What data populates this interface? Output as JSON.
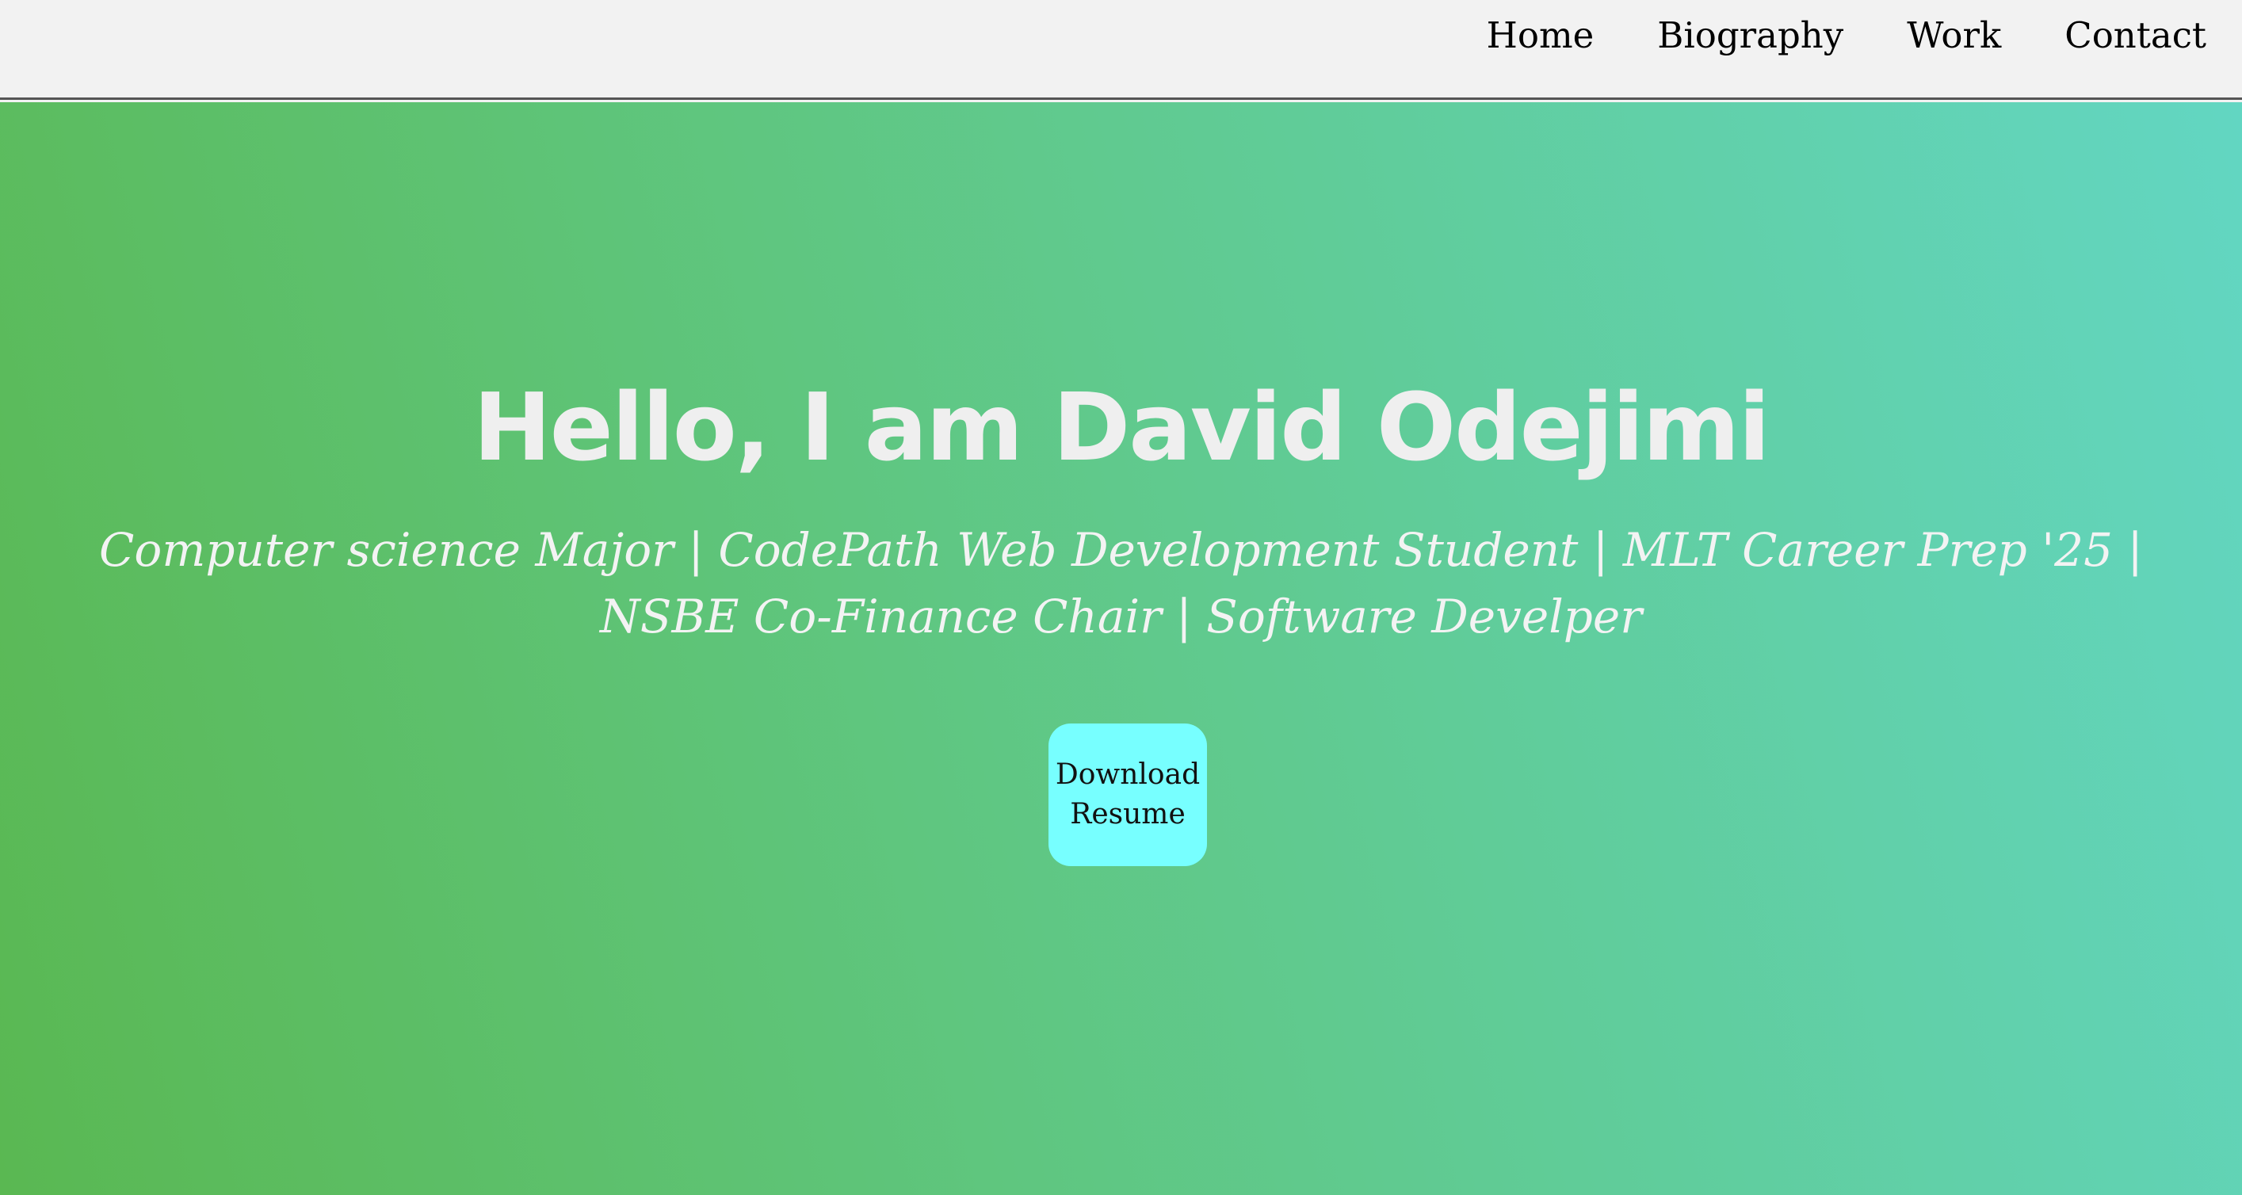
{
  "nav": {
    "items": [
      {
        "label": "Home"
      },
      {
        "label": "Biography"
      },
      {
        "label": "Work"
      },
      {
        "label": "Contact"
      }
    ]
  },
  "hero": {
    "title": "Hello, I am David Odejimi",
    "subtitle": "Computer science Major | CodePath Web Development Student | MLT Career Prep '25 | NSBE Co-Finance Chair | Software Develper",
    "download_button_label": "Download Resume"
  },
  "colors": {
    "gradient_start": "#5ab852",
    "gradient_end": "#62d6c2",
    "button_background": "#77ffff",
    "navbar_background": "#f2f2f2",
    "title_text": "#efefef"
  }
}
